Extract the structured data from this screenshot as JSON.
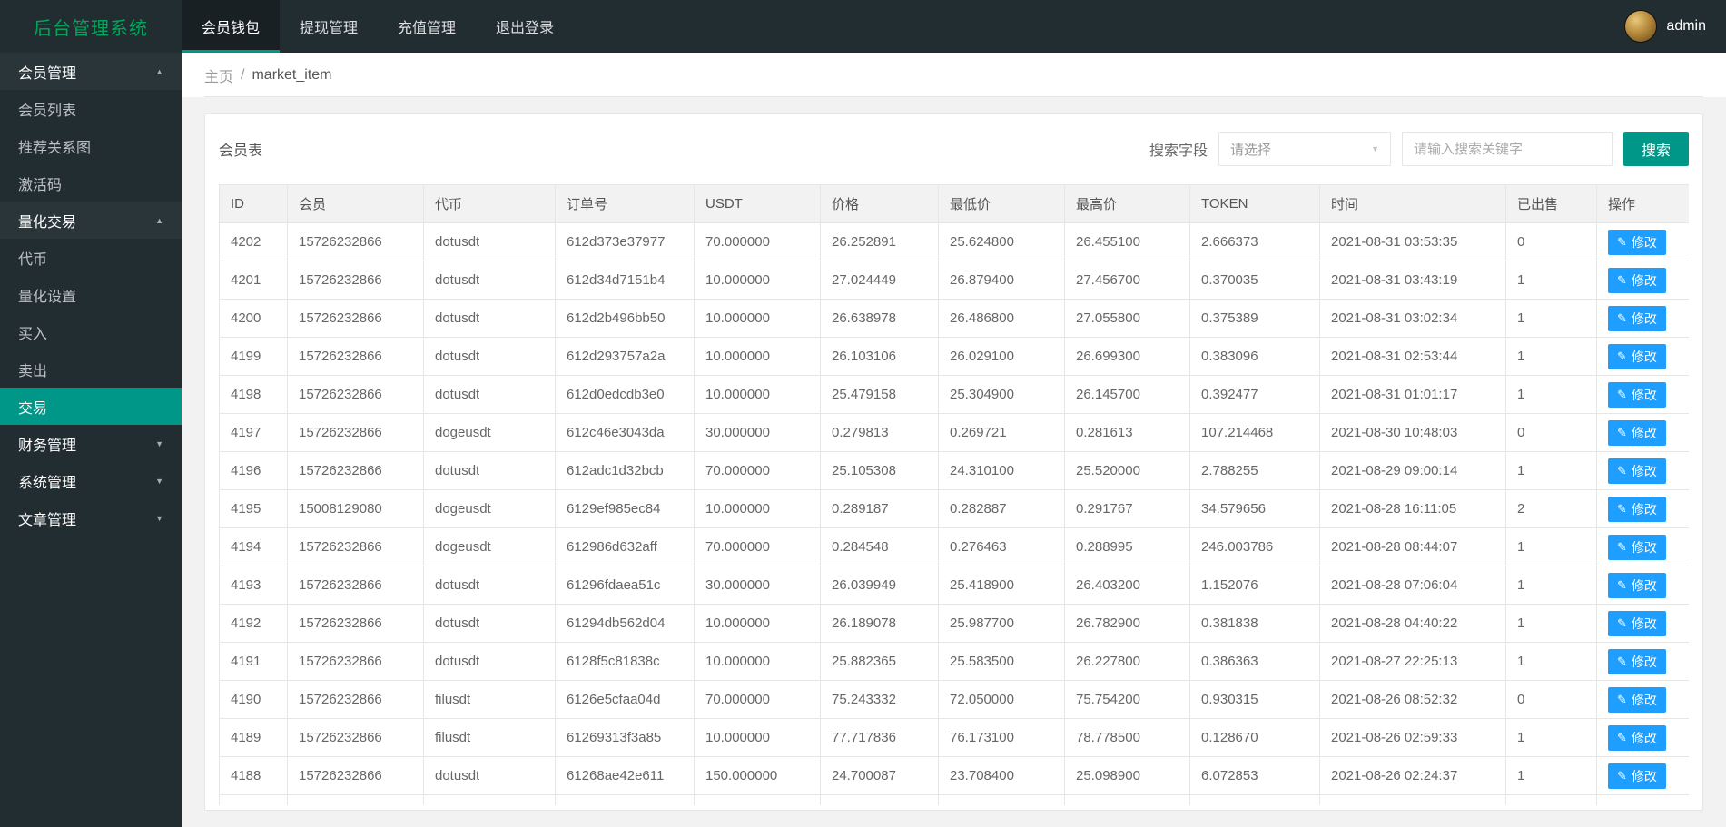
{
  "app": {
    "title": "后台管理系统",
    "admin_name": "admin"
  },
  "colors": {
    "accent_green": "#009688",
    "logo_green": "#00a65a",
    "button_blue": "#1E9FFF",
    "dark_background": "#222d32",
    "table_header_background": "#f2f2f2",
    "border": "#e6e6e6"
  },
  "topnav": {
    "items": [
      {
        "label": "会员钱包",
        "active": true
      },
      {
        "label": "提现管理",
        "active": false
      },
      {
        "label": "充值管理",
        "active": false
      },
      {
        "label": "退出登录",
        "active": false
      }
    ]
  },
  "sidebar": {
    "groups": [
      {
        "label": "会员管理",
        "expanded": true,
        "children": [
          "会员列表",
          "推荐关系图",
          "激活码"
        ],
        "active_child": ""
      },
      {
        "label": "量化交易",
        "expanded": true,
        "children": [
          "代币",
          "量化设置",
          "买入",
          "卖出",
          "交易"
        ],
        "active_child": "交易"
      },
      {
        "label": "财务管理",
        "expanded": false,
        "children": [],
        "active_child": ""
      },
      {
        "label": "系统管理",
        "expanded": false,
        "children": [],
        "active_child": ""
      },
      {
        "label": "文章管理",
        "expanded": false,
        "children": [],
        "active_child": ""
      }
    ]
  },
  "breadcrumb": {
    "home": "主页",
    "separator": "/",
    "current": "market_item"
  },
  "panel": {
    "title": "会员表",
    "search": {
      "field_label": "搜索字段",
      "select_placeholder": "请选择",
      "input_placeholder": "请输入搜索关键字",
      "button_label": "搜索"
    }
  },
  "table": {
    "headers": [
      "ID",
      "会员",
      "代币",
      "订单号",
      "USDT",
      "价格",
      "最低价",
      "最高价",
      "TOKEN",
      "时间",
      "已出售",
      "操作"
    ],
    "edit_label": "修改",
    "rows": [
      [
        "4202",
        "15726232866",
        "dotusdt",
        "612d373e37977",
        "70.000000",
        "26.252891",
        "25.624800",
        "26.455100",
        "2.666373",
        "2021-08-31 03:53:35",
        "0"
      ],
      [
        "4201",
        "15726232866",
        "dotusdt",
        "612d34d7151b4",
        "10.000000",
        "27.024449",
        "26.879400",
        "27.456700",
        "0.370035",
        "2021-08-31 03:43:19",
        "1"
      ],
      [
        "4200",
        "15726232866",
        "dotusdt",
        "612d2b496bb50",
        "10.000000",
        "26.638978",
        "26.486800",
        "27.055800",
        "0.375389",
        "2021-08-31 03:02:34",
        "1"
      ],
      [
        "4199",
        "15726232866",
        "dotusdt",
        "612d293757a2a",
        "10.000000",
        "26.103106",
        "26.029100",
        "26.699300",
        "0.383096",
        "2021-08-31 02:53:44",
        "1"
      ],
      [
        "4198",
        "15726232866",
        "dotusdt",
        "612d0edcdb3e0",
        "10.000000",
        "25.479158",
        "25.304900",
        "26.145700",
        "0.392477",
        "2021-08-31 01:01:17",
        "1"
      ],
      [
        "4197",
        "15726232866",
        "dogeusdt",
        "612c46e3043da",
        "30.000000",
        "0.279813",
        "0.269721",
        "0.281613",
        "107.214468",
        "2021-08-30 10:48:03",
        "0"
      ],
      [
        "4196",
        "15726232866",
        "dotusdt",
        "612adc1d32bcb",
        "70.000000",
        "25.105308",
        "24.310100",
        "25.520000",
        "2.788255",
        "2021-08-29 09:00:14",
        "1"
      ],
      [
        "4195",
        "15008129080",
        "dogeusdt",
        "6129ef985ec84",
        "10.000000",
        "0.289187",
        "0.282887",
        "0.291767",
        "34.579656",
        "2021-08-28 16:11:05",
        "2"
      ],
      [
        "4194",
        "15726232866",
        "dogeusdt",
        "612986d632aff",
        "70.000000",
        "0.284548",
        "0.276463",
        "0.288995",
        "246.003786",
        "2021-08-28 08:44:07",
        "1"
      ],
      [
        "4193",
        "15726232866",
        "dotusdt",
        "61296fdaea51c",
        "30.000000",
        "26.039949",
        "25.418900",
        "26.403200",
        "1.152076",
        "2021-08-28 07:06:04",
        "1"
      ],
      [
        "4192",
        "15726232866",
        "dotusdt",
        "61294db562d04",
        "10.000000",
        "26.189078",
        "25.987700",
        "26.782900",
        "0.381838",
        "2021-08-28 04:40:22",
        "1"
      ],
      [
        "4191",
        "15726232866",
        "dotusdt",
        "6128f5c81838c",
        "10.000000",
        "25.882365",
        "25.583500",
        "26.227800",
        "0.386363",
        "2021-08-27 22:25:13",
        "1"
      ],
      [
        "4190",
        "15726232866",
        "filusdt",
        "6126e5cfaa04d",
        "70.000000",
        "75.243332",
        "72.050000",
        "75.754200",
        "0.930315",
        "2021-08-26 08:52:32",
        "0"
      ],
      [
        "4189",
        "15726232866",
        "filusdt",
        "61269313f3a85",
        "10.000000",
        "77.717836",
        "76.173100",
        "78.778500",
        "0.128670",
        "2021-08-26 02:59:33",
        "1"
      ],
      [
        "4188",
        "15726232866",
        "dotusdt",
        "61268ae42e611",
        "150.000000",
        "24.700087",
        "23.708400",
        "25.098900",
        "6.072853",
        "2021-08-26 02:24:37",
        "1"
      ]
    ]
  }
}
